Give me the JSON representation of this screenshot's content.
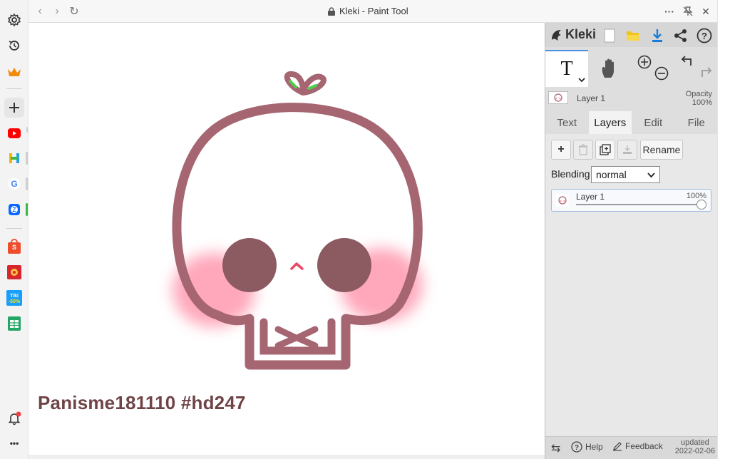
{
  "browser": {
    "title": "Kleki - Paint Tool",
    "nav": {
      "back": "‹",
      "forward": "›",
      "reload": "↻"
    },
    "controls": {
      "more": "···",
      "close": "✕"
    }
  },
  "sidebar": {
    "items": [
      {
        "name": "settings",
        "icon": "gear-icon"
      },
      {
        "name": "history",
        "icon": "history-icon"
      },
      {
        "name": "premium",
        "icon": "crown-icon"
      },
      {
        "name": "add",
        "icon": "plus-icon"
      },
      {
        "name": "youtube",
        "icon": "youtube-icon"
      },
      {
        "name": "h-app",
        "icon": "h-app-icon"
      },
      {
        "name": "google",
        "icon": "google-icon"
      },
      {
        "name": "zalo",
        "icon": "zalo-icon"
      },
      {
        "name": "shopee",
        "icon": "shopee-icon"
      },
      {
        "name": "game",
        "icon": "game-icon"
      },
      {
        "name": "tiki",
        "icon": "tiki-icon",
        "label": "Tiki\n-50%"
      },
      {
        "name": "sheets",
        "icon": "sheets-icon"
      },
      {
        "name": "notifications",
        "icon": "bell-icon"
      },
      {
        "name": "more",
        "icon": "more-icon"
      }
    ],
    "more_label": "•••"
  },
  "canvas": {
    "watermark": "Panisme181110 #hd247",
    "colors": {
      "outline": "#a56672",
      "cheek": "#ff9fb4",
      "eye": "#8c5a61",
      "nose": "#e84a64",
      "leaf": "#4ccf4a"
    }
  },
  "kleki": {
    "logo": "Kleki",
    "header_icons": [
      "new-file-icon",
      "open-folder-icon",
      "download-icon",
      "share-icon",
      "help-icon"
    ],
    "tools": {
      "text_tool": "T",
      "hand_tool": "hand-icon",
      "zoom": [
        "zoom-in-icon",
        "zoom-out-icon"
      ],
      "undo_redo": [
        "undo-icon",
        "redo-icon"
      ]
    },
    "current_layer": {
      "name": "Layer 1",
      "opacity_label": "Opacity",
      "opacity_value": "100%"
    },
    "tabs": [
      "Text",
      "Layers",
      "Edit",
      "File"
    ],
    "active_tab": "Layers",
    "layers_panel": {
      "buttons": {
        "add": "+",
        "rename": "Rename"
      },
      "blending_label": "Blending",
      "blending_value": "normal",
      "layers": [
        {
          "name": "Layer 1",
          "opacity": "100%",
          "opacity_fraction": 1.0
        }
      ]
    },
    "footer": {
      "swap": "⇆",
      "help": "Help",
      "feedback": "Feedback",
      "updated": "updated",
      "date": "2022-02-06"
    }
  }
}
